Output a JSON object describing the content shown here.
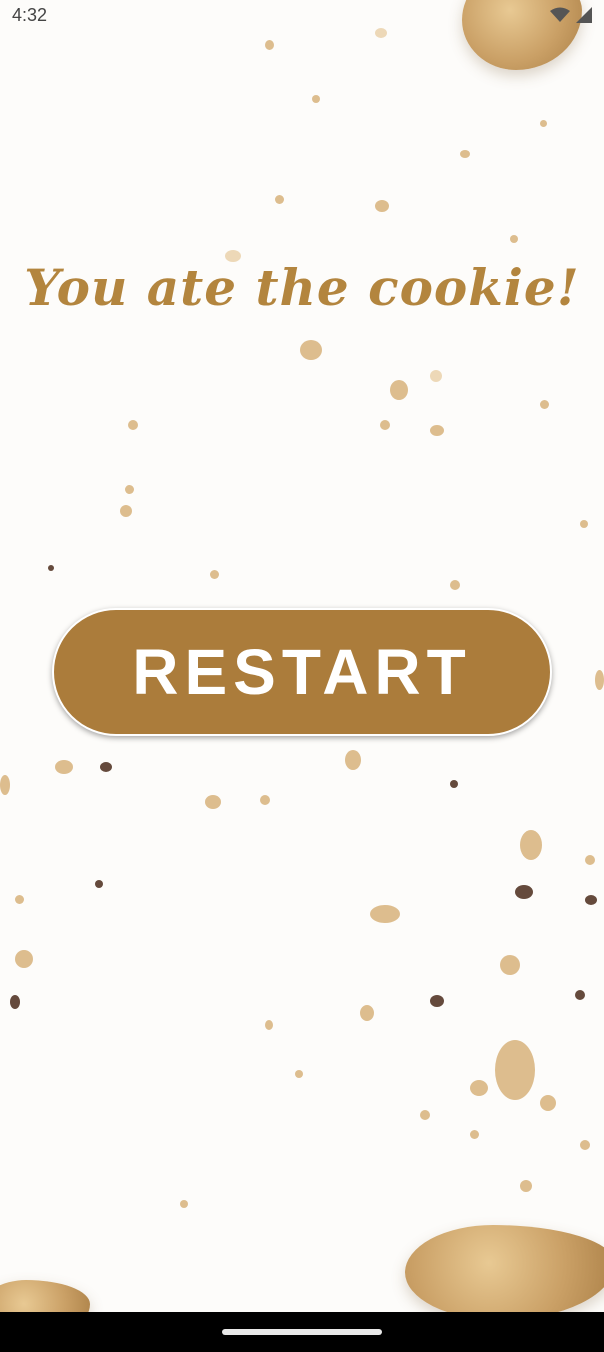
{
  "status_bar": {
    "time": "4:32",
    "icons": [
      "wifi-icon",
      "signal-icon"
    ]
  },
  "title": "You ate the cookie!",
  "restart_button": {
    "label": "RESTART"
  },
  "colors": {
    "accent": "#ab7c3b",
    "title": "#b3853e",
    "background": "#fdfcfa",
    "nav_bar": "#000000"
  }
}
